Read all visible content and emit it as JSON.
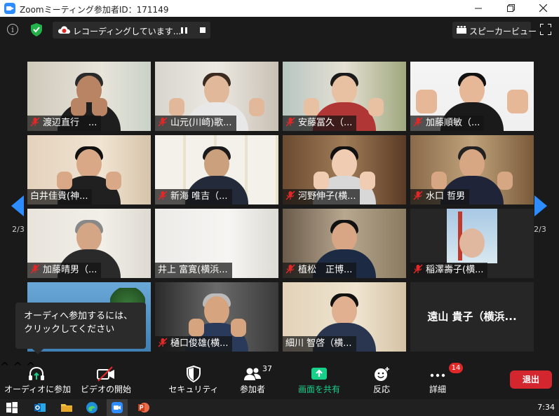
{
  "window": {
    "title": "Zoomミーティング参加者ID：171149",
    "controls": [
      "minimize",
      "maximize",
      "close"
    ]
  },
  "topbar": {
    "recording_text": "レコーディングしています...",
    "speaker_view_label": "スピーカービュー"
  },
  "pagination": {
    "left": "2/3",
    "right": "2/3"
  },
  "participants": [
    {
      "name": "渡辺直行　..."
    },
    {
      "name": "山元(川崎)歌..."
    },
    {
      "name": "安藤冨久（..."
    },
    {
      "name": "加藤順敏（..."
    },
    {
      "name": "白井佳貴(神..."
    },
    {
      "name": "新海 唯吉（..."
    },
    {
      "name": "河野伸子(横..."
    },
    {
      "name": "水口 哲男"
    },
    {
      "name": "加藤晴男（..."
    },
    {
      "name": "井上 富寛(横浜..."
    },
    {
      "name": "植松　正博..."
    },
    {
      "name": "稲澤壽子(横..."
    },
    {
      "name": ""
    },
    {
      "name": "樋口俊雄(横..."
    },
    {
      "name": "細川 智啓（横..."
    },
    {
      "name": "遠山 貴子（横浜..."
    }
  ],
  "tooltip": {
    "text": "オーディへ参加するには、クリックしてください"
  },
  "toolbar": {
    "audio": "オーディオに参加",
    "video": "ビデオの開始",
    "security": "セキュリティ",
    "participants": "参加者",
    "participants_count": "37",
    "share": "画面を共有",
    "reactions": "反応",
    "more": "詳細",
    "more_badge": "14",
    "leave": "退出"
  },
  "taskbar": {
    "clock": "7:34"
  },
  "colors": {
    "accent_blue": "#2d8cff",
    "share_green": "#18d08a",
    "leave_red": "#d4262e",
    "mic_off_red": "#e02828"
  }
}
